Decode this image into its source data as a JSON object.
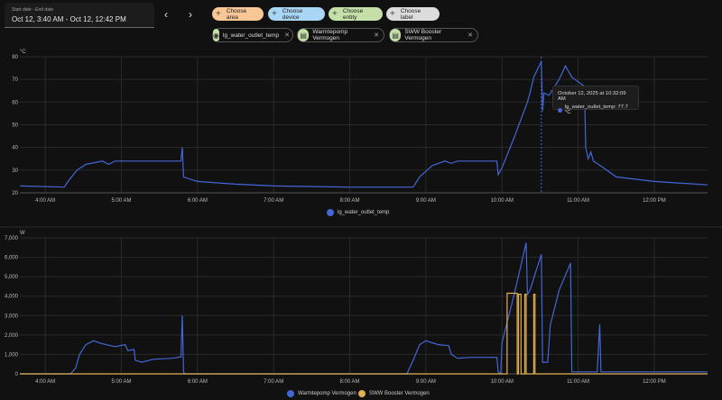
{
  "date_picker": {
    "label": "Start date - End date",
    "value": "Oct 12, 3:40 AM - Oct 12, 12:42 PM"
  },
  "nav": {
    "prev_icon": "chevron-left-icon",
    "next_icon": "chevron-right-icon"
  },
  "choosers": [
    {
      "label": "Choose area",
      "color": "#f7c795"
    },
    {
      "label": "Choose device",
      "color": "#a9d6f5"
    },
    {
      "label": "Choose entity",
      "color": "#c5dfa8"
    },
    {
      "label": "Choose label",
      "color": "#dcdcdc"
    }
  ],
  "selected": [
    {
      "label": "lg_water_outlet_temp",
      "icon": "eye-icon"
    },
    {
      "label": "Warmtepomp Vermogen",
      "icon": "meter-icon"
    },
    {
      "label": "SWW Booster Vermogen",
      "icon": "meter-icon"
    }
  ],
  "tooltip": {
    "title": "October 12, 2025 at 10:32:09 AM",
    "text": "lg_water_outlet_temp: 77.7 °C",
    "time": "10:31"
  },
  "chart_data": [
    {
      "type": "line",
      "unit": "°C",
      "xlim": [
        "03:40",
        "12:42"
      ],
      "ylim": [
        20,
        80
      ],
      "yticks": [
        20,
        30,
        40,
        50,
        60,
        70,
        80
      ],
      "xticks": [
        "4:00 AM",
        "5:00 AM",
        "6:00 AM",
        "7:00 AM",
        "8:00 AM",
        "9:00 AM",
        "10:00 AM",
        "11:00 AM",
        "12:00 PM"
      ],
      "grid": true,
      "legend": "bottom",
      "series": [
        {
          "name": "lg_water_outlet_temp",
          "color": "#4466d6",
          "points": [
            [
              "03:40",
              23
            ],
            [
              "04:15",
              22.5
            ],
            [
              "04:18",
              25
            ],
            [
              "04:25",
              30
            ],
            [
              "04:32",
              32.5
            ],
            [
              "04:45",
              34
            ],
            [
              "04:50",
              32.5
            ],
            [
              "04:55",
              34
            ],
            [
              "05:47",
              34
            ],
            [
              "05:48",
              40
            ],
            [
              "05:49",
              27
            ],
            [
              "06:00",
              25
            ],
            [
              "06:30",
              23.8
            ],
            [
              "07:00",
              23
            ],
            [
              "08:00",
              22.5
            ],
            [
              "08:50",
              22.5
            ],
            [
              "08:55",
              27
            ],
            [
              "09:05",
              32
            ],
            [
              "09:15",
              34
            ],
            [
              "09:20",
              33
            ],
            [
              "09:25",
              34
            ],
            [
              "09:56",
              34
            ],
            [
              "09:57",
              28
            ],
            [
              "10:00",
              31
            ],
            [
              "10:10",
              45
            ],
            [
              "10:20",
              60
            ],
            [
              "10:22",
              64
            ],
            [
              "10:25",
              71
            ],
            [
              "10:31",
              78
            ],
            [
              "10:32",
              56
            ],
            [
              "10:33",
              64
            ],
            [
              "10:37",
              63
            ],
            [
              "10:45",
              70
            ],
            [
              "10:50",
              76
            ],
            [
              "10:55",
              71
            ],
            [
              "11:05",
              67
            ],
            [
              "11:06",
              40
            ],
            [
              "11:08",
              35
            ],
            [
              "11:10",
              38
            ],
            [
              "11:12",
              34
            ],
            [
              "11:20",
              31
            ],
            [
              "11:30",
              27
            ],
            [
              "12:00",
              25
            ],
            [
              "12:42",
              23.5
            ]
          ]
        }
      ]
    },
    {
      "type": "line",
      "unit": "W",
      "xlim": [
        "03:40",
        "12:42"
      ],
      "ylim": [
        0,
        7000
      ],
      "yticks": [
        0,
        1000,
        2000,
        3000,
        4000,
        5000,
        6000,
        7000
      ],
      "ytick_labels": [
        "0",
        "1,000",
        "2,000",
        "3,000",
        "4,000",
        "5,000",
        "6,000",
        "7,000"
      ],
      "xticks": [
        "4:00 AM",
        "5:00 AM",
        "6:00 AM",
        "7:00 AM",
        "8:00 AM",
        "9:00 AM",
        "10:00 AM",
        "11:00 AM",
        "12:00 PM"
      ],
      "grid": true,
      "legend": "bottom",
      "series": [
        {
          "name": "Warmtepomp Vermogen",
          "color": "#4466d6",
          "points": [
            [
              "03:40",
              0
            ],
            [
              "04:20",
              0
            ],
            [
              "04:24",
              300
            ],
            [
              "04:27",
              1000
            ],
            [
              "04:32",
              1500
            ],
            [
              "04:38",
              1700
            ],
            [
              "04:45",
              1550
            ],
            [
              "04:55",
              1400
            ],
            [
              "05:03",
              1500
            ],
            [
              "05:05",
              1200
            ],
            [
              "05:10",
              1250
            ],
            [
              "05:11",
              700
            ],
            [
              "05:16",
              600
            ],
            [
              "05:25",
              750
            ],
            [
              "05:40",
              800
            ],
            [
              "05:47",
              870
            ],
            [
              "05:48",
              3000
            ],
            [
              "05:49",
              100
            ],
            [
              "05:50",
              0
            ],
            [
              "08:45",
              0
            ],
            [
              "08:50",
              700
            ],
            [
              "08:55",
              1500
            ],
            [
              "09:00",
              1700
            ],
            [
              "09:10",
              1500
            ],
            [
              "09:18",
              1450
            ],
            [
              "09:20",
              1000
            ],
            [
              "09:25",
              800
            ],
            [
              "09:35",
              850
            ],
            [
              "09:56",
              850
            ],
            [
              "09:57",
              100
            ],
            [
              "09:59",
              0
            ],
            [
              "10:00",
              1600
            ],
            [
              "10:10",
              4200
            ],
            [
              "10:19",
              6750
            ],
            [
              "10:20",
              4100
            ],
            [
              "10:22",
              4300
            ],
            [
              "10:31",
              6150
            ],
            [
              "10:32",
              600
            ],
            [
              "10:36",
              600
            ],
            [
              "10:38",
              2500
            ],
            [
              "10:45",
              4300
            ],
            [
              "10:54",
              5700
            ],
            [
              "10:55",
              100
            ],
            [
              "11:15",
              100
            ],
            [
              "11:17",
              2550
            ],
            [
              "11:18",
              100
            ],
            [
              "12:42",
              100
            ]
          ]
        },
        {
          "name": "SWW Booster Vermogen",
          "color": "#e2b04f",
          "points": [
            [
              "03:40",
              0
            ],
            [
              "10:04",
              0
            ],
            [
              "10:04",
              4150
            ],
            [
              "10:12",
              4150
            ],
            [
              "10:12",
              0
            ],
            [
              "10:13",
              0
            ],
            [
              "10:13",
              4100
            ],
            [
              "10:15",
              4100
            ],
            [
              "10:15",
              0
            ],
            [
              "10:18",
              0
            ],
            [
              "10:18",
              4100
            ],
            [
              "10:19",
              4100
            ],
            [
              "10:19",
              0
            ],
            [
              "10:25",
              0
            ],
            [
              "10:25",
              4100
            ],
            [
              "10:26",
              4100
            ],
            [
              "10:26",
              0
            ],
            [
              "12:42",
              0
            ]
          ]
        }
      ]
    }
  ]
}
